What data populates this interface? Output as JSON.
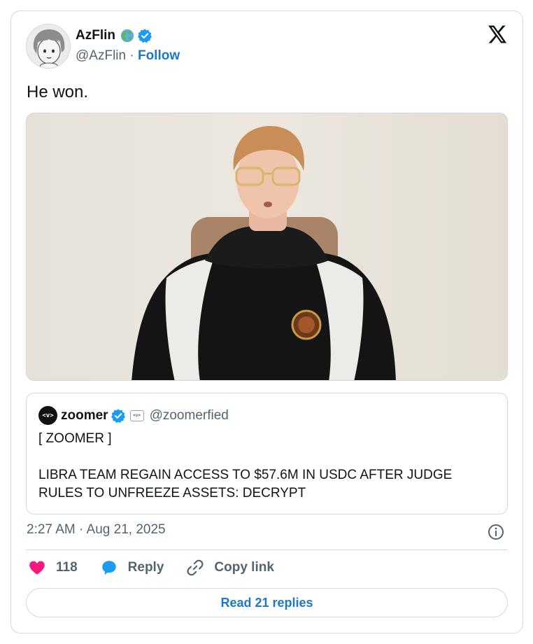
{
  "author": {
    "name": "AzFlin",
    "handle": "@AzFlin",
    "separator": " · ",
    "follow_label": "Follow"
  },
  "tweet": {
    "text": "He won."
  },
  "quoted": {
    "logo_text": "<v>",
    "name": "zoomer",
    "badge_text": "<v>",
    "handle": "@zoomerfied",
    "line1": "[ ZOOMER ]",
    "body": "LIBRA TEAM REGAIN ACCESS TO $57.6M IN USDC AFTER JUDGE RULES TO UNFREEZE ASSETS: DECRYPT"
  },
  "meta": {
    "timestamp": "2:27 AM · Aug 21, 2025"
  },
  "actions": {
    "likes": "118",
    "reply_label": "Reply",
    "copy_label": "Copy link"
  },
  "read_replies_label": "Read 21 replies",
  "colors": {
    "accent": "#1d77c8",
    "verified": "#1d9bf0",
    "like": "#f91880",
    "muted": "#536471",
    "border": "#cfd9de"
  },
  "icons": [
    "globe-emoji-icon",
    "verified-badge-icon",
    "x-logo-icon",
    "info-icon",
    "heart-icon",
    "reply-bubble-icon",
    "link-icon"
  ]
}
